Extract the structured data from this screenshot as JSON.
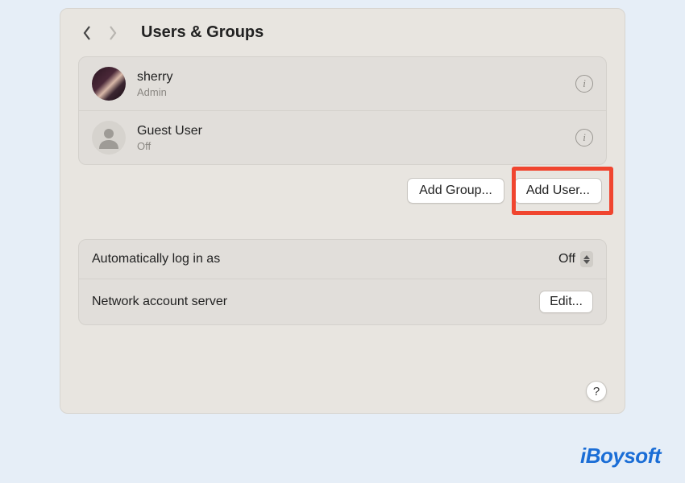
{
  "header": {
    "title": "Users & Groups"
  },
  "users": [
    {
      "name": "sherry",
      "role": "Admin"
    },
    {
      "name": "Guest User",
      "role": "Off"
    }
  ],
  "buttons": {
    "add_group": "Add Group...",
    "add_user": "Add User..."
  },
  "settings": {
    "auto_login_label": "Automatically log in as",
    "auto_login_value": "Off",
    "network_server_label": "Network account server",
    "network_server_button": "Edit..."
  },
  "help_label": "?",
  "watermark": "iBoysoft",
  "highlight_color": "#f0452f"
}
